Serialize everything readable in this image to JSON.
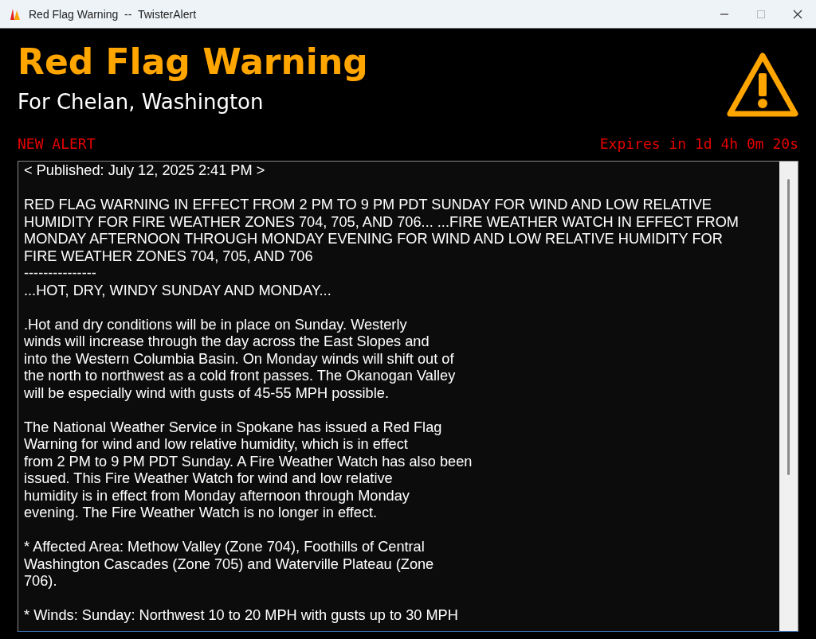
{
  "window": {
    "title": "Red Flag Warning  --  TwisterAlert"
  },
  "alert": {
    "title": "Red Flag Warning",
    "subtitle": "For Chelan, Washington",
    "status": "NEW ALERT",
    "expires": "Expires in 1d 4h 0m 20s"
  },
  "message": {
    "paragraphs": [
      [
        "< Published: July 12, 2025 2:41 PM >"
      ],
      [
        "RED FLAG WARNING IN EFFECT FROM 2 PM TO 9 PM PDT SUNDAY FOR WIND AND LOW RELATIVE",
        "HUMIDITY FOR FIRE WEATHER ZONES 704, 705, AND 706... ...FIRE WEATHER WATCH IN EFFECT FROM",
        "MONDAY AFTERNOON THROUGH MONDAY EVENING FOR WIND AND LOW RELATIVE HUMIDITY FOR",
        "FIRE WEATHER ZONES 704, 705, AND 706",
        "---------------",
        "...HOT, DRY, WINDY SUNDAY AND MONDAY..."
      ],
      [
        ".Hot and dry conditions will be in place on Sunday. Westerly",
        "winds will increase through the day across the East Slopes and",
        "into the Western Columbia Basin. On Monday winds will shift out of",
        "the north to northwest as a cold front passes. The Okanogan Valley",
        "will be especially wind with gusts of 45-55 MPH possible."
      ],
      [
        "The National Weather Service in Spokane has issued a Red Flag",
        "Warning for wind and low relative humidity, which is in effect",
        "from 2 PM to 9 PM PDT Sunday. A Fire Weather Watch has also been",
        "issued. This Fire Weather Watch for wind and low relative",
        "humidity is in effect from Monday afternoon through Monday",
        "evening. The Fire Weather Watch is no longer in effect."
      ],
      [
        "* Affected Area: Methow Valley (Zone 704), Foothills of Central",
        "Washington Cascades (Zone 705) and Waterville Plateau (Zone",
        "706)."
      ],
      [
        "* Winds: Sunday: Northwest 10 to 20 MPH with gusts up to 30 MPH"
      ]
    ]
  }
}
